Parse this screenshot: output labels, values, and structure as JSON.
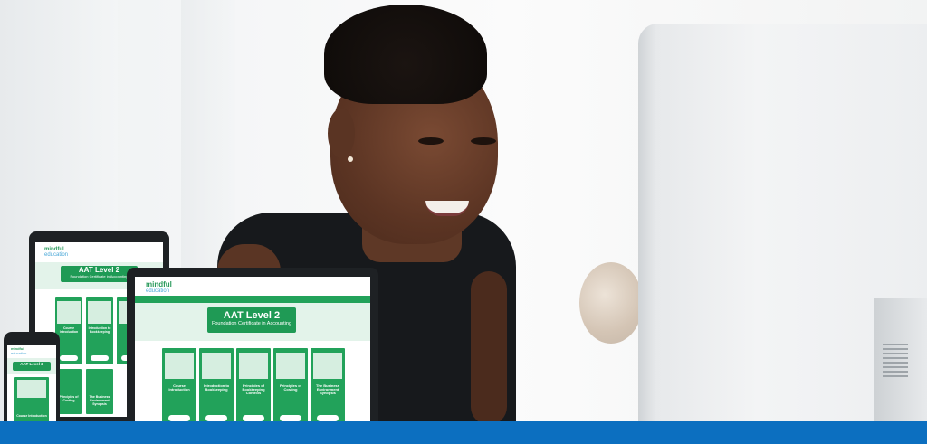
{
  "brand": {
    "name": "mindful",
    "sub": "education"
  },
  "course": {
    "title": "AAT Level 2",
    "subtitle": "Foundation Certificate in Accounting"
  },
  "modules": [
    {
      "title": "Course Introduction",
      "cta": "Learn more"
    },
    {
      "title": "Introduction to Bookkeeping",
      "cta": "Learn more"
    },
    {
      "title": "Principles of Bookkeeping Controls",
      "cta": "Learn more"
    },
    {
      "title": "Principles of Costing",
      "cta": "Learn more"
    },
    {
      "title": "The Business Environment Synopsis",
      "cta": "Learn more"
    }
  ],
  "colors": {
    "brand_green": "#22a25a",
    "brand_blue": "#4aa8d8",
    "footer_blue": "#0c6fc0"
  }
}
